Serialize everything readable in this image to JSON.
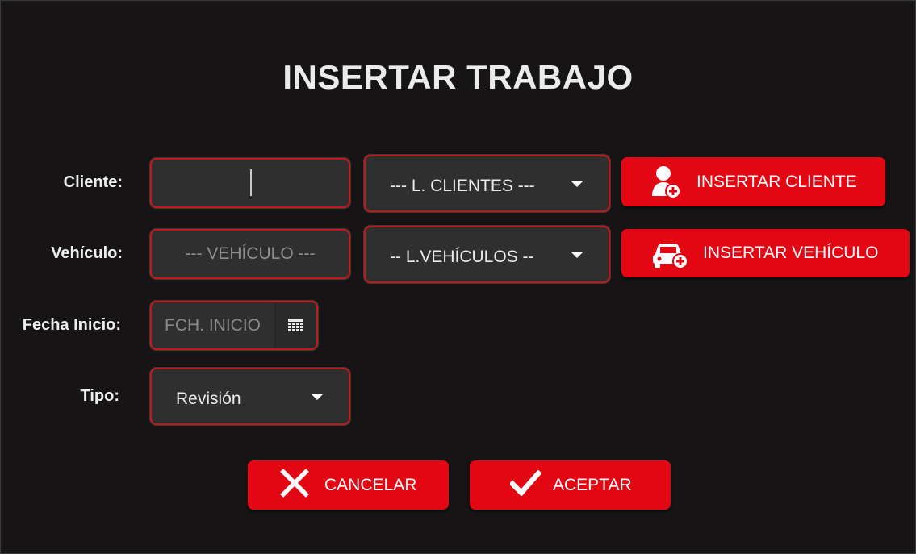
{
  "title": "INSERTAR TRABAJO",
  "labels": {
    "cliente": "Cliente:",
    "vehiculo": "Vehículo:",
    "fecha_inicio": "Fecha Inicio:",
    "tipo": "Tipo:"
  },
  "cliente": {
    "value": "",
    "list_selected": "--- L. CLIENTES ---",
    "insert_button": "INSERTAR CLIENTE",
    "insert_icon": "add-user-icon"
  },
  "vehiculo": {
    "placeholder": "--- VEHÍCULO ---",
    "list_selected": "-- L.VEHÍCULOS --",
    "insert_button": "INSERTAR VEHÍCULO",
    "insert_icon": "add-car-icon"
  },
  "fecha_inicio": {
    "placeholder": "FCH. INICIO",
    "picker_icon": "calendar-icon"
  },
  "tipo": {
    "selected": "Revisión"
  },
  "actions": {
    "cancel": "CANCELAR",
    "cancel_icon": "close-icon",
    "accept": "ACEPTAR",
    "accept_icon": "check-icon"
  },
  "colors": {
    "accent": "#e30613",
    "field_border": "#c5161b",
    "background": "#161415",
    "field_bg": "#2f2f2f"
  }
}
